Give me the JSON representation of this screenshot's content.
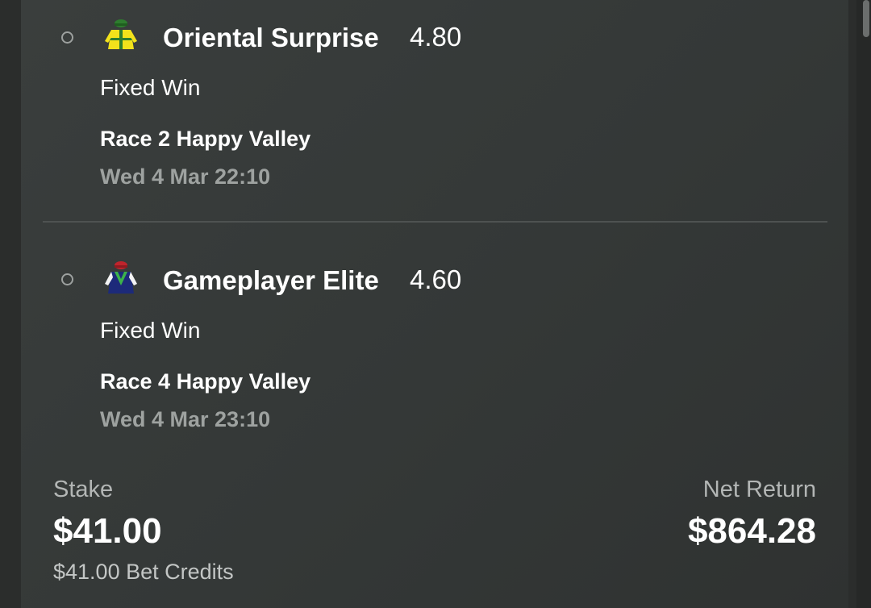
{
  "legs": [
    {
      "runner_name": "Oriental Surprise",
      "odds": "4.80",
      "bet_type": "Fixed Win",
      "race": "Race 2 Happy Valley",
      "time": "Wed 4 Mar 22:10",
      "silk_icon": "jockey-silk-yellow-green-icon"
    },
    {
      "runner_name": "Gameplayer Elite",
      "odds": "4.60",
      "bet_type": "Fixed Win",
      "race": "Race 4 Happy Valley",
      "time": "Wed 4 Mar 23:10",
      "silk_icon": "jockey-silk-navy-white-icon"
    }
  ],
  "summary": {
    "stake_label": "Stake",
    "stake_amount": "$41.00",
    "bet_credits": "$41.00 Bet Credits",
    "return_label": "Net Return",
    "return_amount": "$864.28"
  },
  "colors": {
    "background": "#2b2d2c",
    "panel": "#363a39",
    "muted_text": "#9ea2a0",
    "primary_text": "#ffffff"
  }
}
